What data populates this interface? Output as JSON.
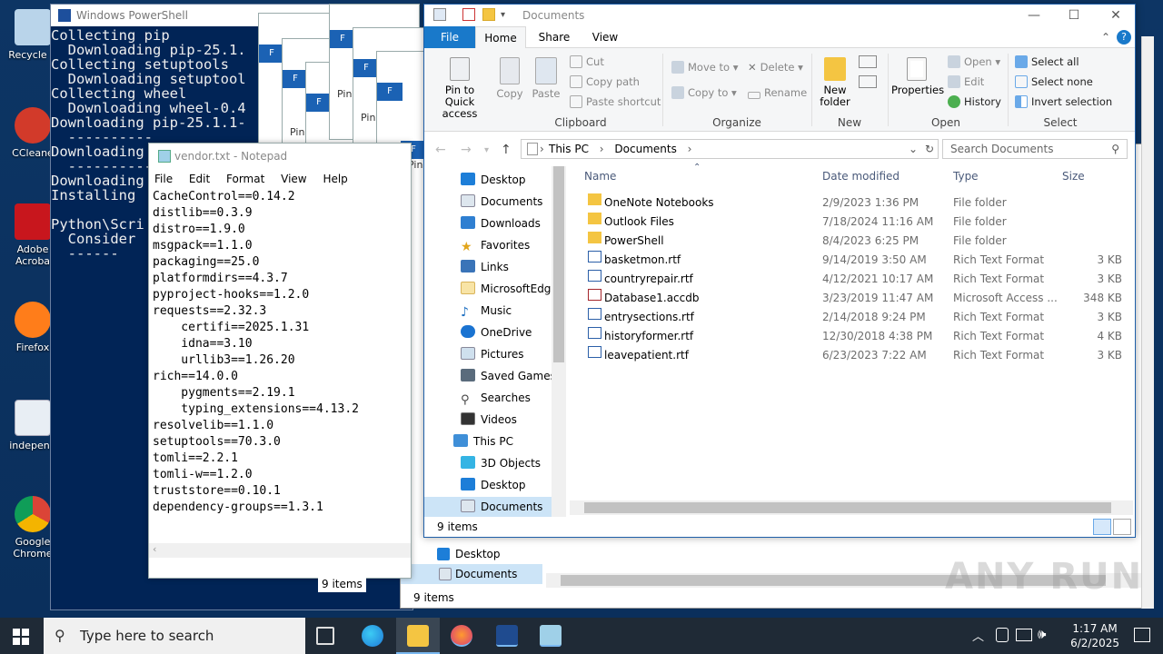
{
  "desktop": {
    "icons": [
      {
        "label": "Recycle Bin",
        "display": "Recycle B"
      },
      {
        "label": "CCleaner",
        "display": "CCleane"
      },
      {
        "label": "Adobe Acrobat",
        "display": "Adobe Acroba"
      },
      {
        "label": "Firefox",
        "display": "Firefox"
      },
      {
        "label": "independ",
        "display": "independ"
      },
      {
        "label": "Google Chrome",
        "display": "Google Chrome"
      }
    ]
  },
  "powershell": {
    "title": "Windows PowerShell",
    "text": "Collecting pip\n  Downloading pip-25.1.\nCollecting setuptools\n  Downloading setuptool\nCollecting wheel\n  Downloading wheel-0.4\nDownloading pip-25.1.1-\n  ----------\nDownloading\n  ----------\nDownloading\nInstalling\n\nPython\\Scri\n  Consider\n  ------"
  },
  "notepad": {
    "title": "vendor.txt - Notepad",
    "menu": [
      "File",
      "Edit",
      "Format",
      "View",
      "Help"
    ],
    "content": "CacheControl==0.14.2\ndistlib==0.3.9\ndistro==1.9.0\nmsgpack==1.1.0\npackaging==25.0\nplatformdirs==4.3.7\npyproject-hooks==1.2.0\nrequests==2.32.3\n    certifi==2025.1.31\n    idna==3.10\n    urllib3==1.26.20\nrich==14.0.0\n    pygments==2.19.1\n    typing_extensions==4.13.2\nresolvelib==1.1.0\nsetuptools==70.3.0\ntomli==2.2.1\ntomli-w==1.2.0\ntruststore==0.10.1\ndependency-groups==1.3.1"
  },
  "back_windows": {
    "pin_label": "Pin",
    "status1": "9 items",
    "status2": "9 items",
    "nav_desktop": "Desktop",
    "nav_documents": "Documents"
  },
  "explorer": {
    "title": "Documents",
    "tabs": [
      "File",
      "Home",
      "Share",
      "View"
    ],
    "ribbon": {
      "pin": "Pin to Quick access",
      "copy": "Copy",
      "paste": "Paste",
      "cut": "Cut",
      "copy_path": "Copy path",
      "paste_shortcut": "Paste shortcut",
      "clipboard": "Clipboard",
      "move_to": "Move to",
      "copy_to": "Copy to",
      "delete": "Delete",
      "rename": "Rename",
      "organize": "Organize",
      "new_folder": "New folder",
      "new": "New",
      "properties": "Properties",
      "open_btn": "Open",
      "edit": "Edit",
      "history": "History",
      "open_grp": "Open",
      "select_all": "Select all",
      "select_none": "Select none",
      "invert": "Invert selection",
      "select_grp": "Select"
    },
    "address": [
      "This PC",
      "Documents"
    ],
    "search_placeholder": "Search Documents",
    "nav": [
      "Desktop",
      "Documents",
      "Downloads",
      "Favorites",
      "Links",
      "MicrosoftEdge",
      "Music",
      "OneDrive",
      "Pictures",
      "Saved Games",
      "Searches",
      "Videos",
      "This PC",
      "3D Objects",
      "Desktop",
      "Documents"
    ],
    "columns": [
      "Name",
      "Date modified",
      "Type",
      "Size"
    ],
    "files": [
      {
        "name": "OneNote Notebooks",
        "date": "2/9/2023 1:36 PM",
        "type": "File folder",
        "size": ""
      },
      {
        "name": "Outlook Files",
        "date": "7/18/2024 11:16 AM",
        "type": "File folder",
        "size": ""
      },
      {
        "name": "PowerShell",
        "date": "8/4/2023 6:25 PM",
        "type": "File folder",
        "size": ""
      },
      {
        "name": "basketmon.rtf",
        "date": "9/14/2019 3:50 AM",
        "type": "Rich Text Format",
        "size": "3 KB"
      },
      {
        "name": "countryrepair.rtf",
        "date": "4/12/2021 10:17 AM",
        "type": "Rich Text Format",
        "size": "3 KB"
      },
      {
        "name": "Database1.accdb",
        "date": "3/23/2019 11:47 AM",
        "type": "Microsoft Access ...",
        "size": "348 KB"
      },
      {
        "name": "entrysections.rtf",
        "date": "2/14/2018 9:24 PM",
        "type": "Rich Text Format",
        "size": "3 KB"
      },
      {
        "name": "historyformer.rtf",
        "date": "12/30/2018 4:38 PM",
        "type": "Rich Text Format",
        "size": "4 KB"
      },
      {
        "name": "leavepatient.rtf",
        "date": "6/23/2023 7:22 AM",
        "type": "Rich Text Format",
        "size": "3 KB"
      }
    ],
    "status": "9 items"
  },
  "taskbar": {
    "search_placeholder": "Type here to search",
    "time": "1:17 AM",
    "date": "6/2/2025"
  },
  "watermark": "ANY RUN"
}
